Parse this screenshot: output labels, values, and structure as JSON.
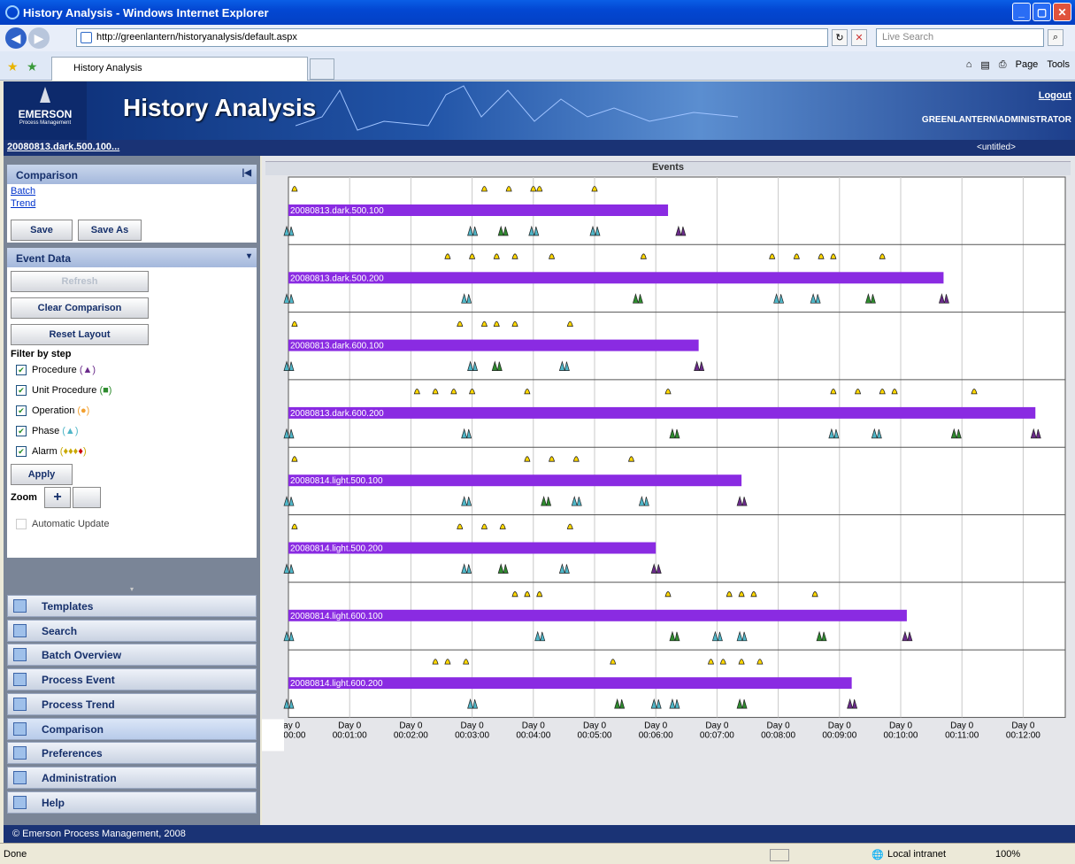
{
  "window": {
    "title": "History Analysis - Windows Internet Explorer"
  },
  "browser": {
    "url": "http://greenlantern/historyanalysis/default.aspx",
    "search_placeholder": "Live Search",
    "tab_title": "History Analysis",
    "toolbar": {
      "page": "Page",
      "tools": "Tools"
    }
  },
  "app": {
    "brand": "EMERSON",
    "brand_sub": "Process Management",
    "title": "History Analysis",
    "logout": "Logout",
    "user": "GREENLANTERN\\ADMINISTRATOR",
    "batch_link": "20080813.dark.500.100...",
    "layout_name": "<untitled>"
  },
  "comparison_panel": {
    "title": "Comparison",
    "links": [
      "Batch",
      "Trend"
    ],
    "save": "Save",
    "save_as": "Save As"
  },
  "event_panel": {
    "title": "Event Data",
    "refresh": "Refresh",
    "clear": "Clear Comparison",
    "reset": "Reset Layout",
    "filter_label": "Filter by step",
    "filters": [
      "Procedure",
      "Unit Procedure",
      "Operation",
      "Phase",
      "Alarm"
    ],
    "apply": "Apply",
    "zoom": "Zoom",
    "auto_update": "Automatic Update"
  },
  "nav": [
    "Templates",
    "Search",
    "Batch Overview",
    "Process Event",
    "Process Trend",
    "Comparison",
    "Preferences",
    "Administration",
    "Help"
  ],
  "nav_active": "Comparison",
  "events_title": "Events",
  "x_ticks": [
    [
      "Day 0",
      "00:00:00"
    ],
    [
      "Day 0",
      "00:01:00"
    ],
    [
      "Day 0",
      "00:02:00"
    ],
    [
      "Day 0",
      "00:03:00"
    ],
    [
      "Day 0",
      "00:04:00"
    ],
    [
      "Day 0",
      "00:05:00"
    ],
    [
      "Day 0",
      "00:06:00"
    ],
    [
      "Day 0",
      "00:07:00"
    ],
    [
      "Day 0",
      "00:08:00"
    ],
    [
      "Day 0",
      "00:09:00"
    ],
    [
      "Day 0",
      "00:10:00"
    ],
    [
      "Day 0",
      "00:11:00"
    ],
    [
      "Day 0",
      "00:12:00"
    ]
  ],
  "colors": {
    "bar": "#8a2be2",
    "alarm": "#ffd700",
    "phase": "#4fb6c8",
    "unit": "#2e8b2e",
    "procedure": "#6a2a8a",
    "operation": "#f2a030"
  },
  "chart_data": {
    "type": "timeline",
    "x_unit": "minutes",
    "xlim": [
      0,
      12.3
    ],
    "rows": [
      {
        "batch": "20080813.dark.500.100",
        "duration": 6.2,
        "alarms": [
          0.1,
          3.2,
          3.6,
          4.0,
          4.1,
          5.0
        ],
        "steps": [
          0.0,
          3.0,
          3.5,
          4.0,
          5.0,
          6.4
        ]
      },
      {
        "batch": "20080813.dark.500.200",
        "duration": 10.7,
        "alarms": [
          2.6,
          3.0,
          3.4,
          3.7,
          4.3,
          5.8,
          7.9,
          8.3,
          8.7,
          8.9,
          9.7
        ],
        "steps": [
          0.0,
          2.9,
          5.7,
          8.0,
          8.6,
          9.5,
          10.7
        ]
      },
      {
        "batch": "20080813.dark.600.100",
        "duration": 6.7,
        "alarms": [
          0.1,
          2.8,
          3.2,
          3.4,
          3.7,
          4.6
        ],
        "steps": [
          0.0,
          3.0,
          3.4,
          4.5,
          6.7
        ]
      },
      {
        "batch": "20080813.dark.600.200",
        "duration": 12.2,
        "alarms": [
          2.1,
          2.4,
          2.7,
          3.0,
          3.9,
          6.2,
          8.9,
          9.3,
          9.7,
          9.9,
          11.2
        ],
        "steps": [
          0.0,
          2.9,
          6.3,
          8.9,
          9.6,
          10.9,
          12.2
        ]
      },
      {
        "batch": "20080814.light.500.100",
        "duration": 7.4,
        "alarms": [
          0.1,
          3.9,
          4.3,
          4.7,
          5.6
        ],
        "steps": [
          0.0,
          2.9,
          4.2,
          4.7,
          5.8,
          7.4
        ]
      },
      {
        "batch": "20080814.light.500.200",
        "duration": 6.0,
        "alarms": [
          0.1,
          2.8,
          3.2,
          3.5,
          4.6
        ],
        "steps": [
          0.0,
          2.9,
          3.5,
          4.5,
          6.0
        ]
      },
      {
        "batch": "20080814.light.600.100",
        "duration": 10.1,
        "alarms": [
          3.7,
          3.9,
          4.1,
          6.2,
          7.2,
          7.4,
          7.6,
          8.6
        ],
        "steps": [
          0.0,
          4.1,
          6.3,
          7.0,
          7.4,
          8.7,
          10.1
        ]
      },
      {
        "batch": "20080814.light.600.200",
        "duration": 9.2,
        "alarms": [
          2.4,
          2.6,
          2.9,
          5.3,
          6.9,
          7.1,
          7.4,
          7.7
        ],
        "steps": [
          0.0,
          3.0,
          5.4,
          6.0,
          6.3,
          7.4,
          9.2
        ]
      }
    ]
  },
  "footer": "© Emerson Process Management, 2008",
  "status": {
    "left": "Done",
    "zone": "Local intranet",
    "zoom": "100%"
  }
}
